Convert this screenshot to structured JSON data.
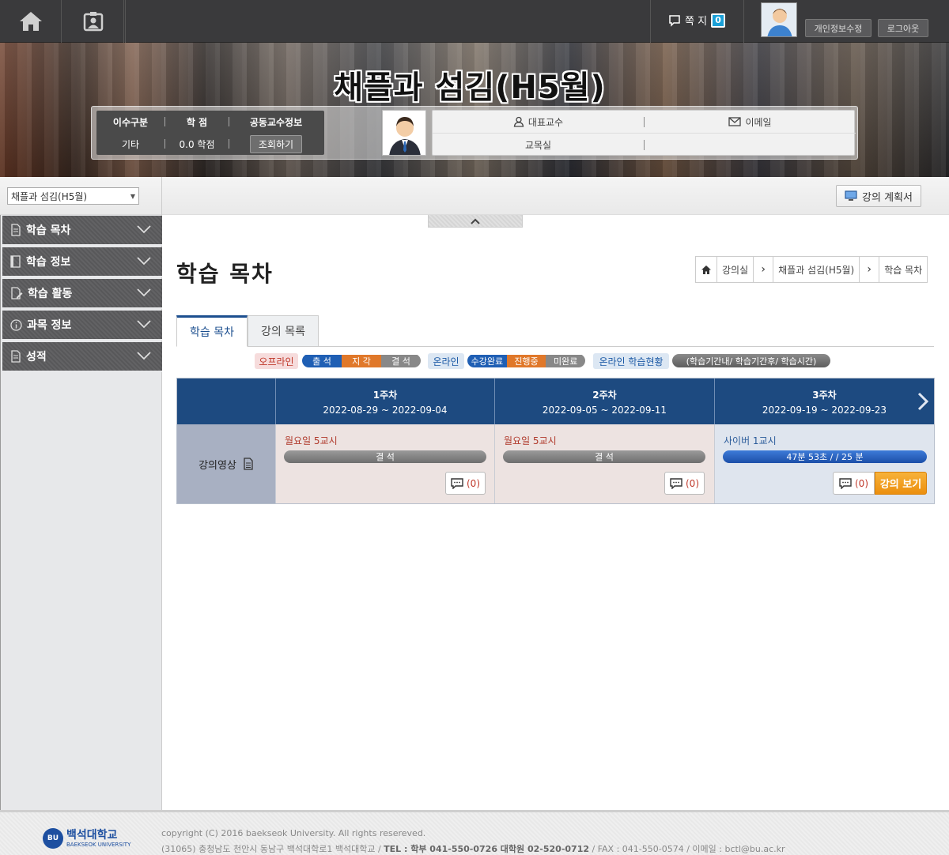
{
  "topbar": {
    "message_label": "쪽 지",
    "message_count": "0",
    "profile_button": "개인정보수정",
    "logout_button": "로그아웃"
  },
  "banner": {
    "course_title": "채플과 섬김(H5월)",
    "info": {
      "col1_header": "이수구분",
      "col2_header": "학 점",
      "col3_header": "공동교수정보",
      "col1_value": "기타",
      "col2_value": "0.0 학점",
      "query_button": "조회하기"
    },
    "professor": {
      "rep_label": "대표교수",
      "email_label": "이메일",
      "office_label": "교목실",
      "email_value": ""
    }
  },
  "subbar": {
    "course_select_value": "채플과 섬김(H5월)",
    "plan_button": "강의 계획서"
  },
  "sidebar": {
    "items": [
      {
        "label": "학습 목차"
      },
      {
        "label": "학습 정보"
      },
      {
        "label": "학습 활동"
      },
      {
        "label": "과목 정보"
      },
      {
        "label": "성적"
      }
    ]
  },
  "main": {
    "page_title": "학습 목차",
    "breadcrumb": [
      "강의실",
      "채플과 섬김(H5월)",
      "학습 목차"
    ],
    "tabs": [
      {
        "label": "학습 목차",
        "active": true
      },
      {
        "label": "강의 목록",
        "active": false
      }
    ],
    "legend": {
      "offline": "오프라인",
      "attend": "출 석",
      "late": "지 각",
      "absent": "결 석",
      "online": "온라인",
      "complete": "수강완료",
      "progress": "진행중",
      "incomplete": "미완료",
      "online_status": "온라인 학습현황",
      "period": "(학습기간내/ 학습기간후/ 학습시간)"
    },
    "weeks": [
      {
        "title": "1주차",
        "range": "2022-08-29 ~ 2022-09-04"
      },
      {
        "title": "2주차",
        "range": "2022-09-05 ~ 2022-09-11"
      },
      {
        "title": "3주차",
        "range": "2022-09-19 ~ 2022-09-23"
      }
    ],
    "row_label": "강의영상",
    "cells": [
      {
        "title": "월요일 5교시",
        "bar": "결 석",
        "comments": "(0)"
      },
      {
        "title": "월요일 5교시",
        "bar": "결 석",
        "comments": "(0)"
      },
      {
        "title": "사이버 1교시",
        "bar": "47분 53초 / / 25 분",
        "comments": "(0)",
        "watch_button": "강의 보기"
      }
    ]
  },
  "colors": {
    "navy": "#1d4a80",
    "accent_orange": "#ec8f0e",
    "attend": "#1f5fb4",
    "late": "#e0782a",
    "absent_gray": "#888888"
  },
  "footer": {
    "logo_ko": "백석대학교",
    "logo_en": "BAEKSEOK UNIVERSITY",
    "copyright": "copyright (C) 2016 baekseok University. All rights resereved.",
    "address": "(31065) 충청남도 천안시 동남구 백석대학로1 백석대학교 / ",
    "tel_label": "TEL : 학부 041-550-0726  대학원 02-520-0712",
    "fax_email": " / FAX : 041-550-0574 / 이메일 : bctl@bu.ac.kr"
  }
}
